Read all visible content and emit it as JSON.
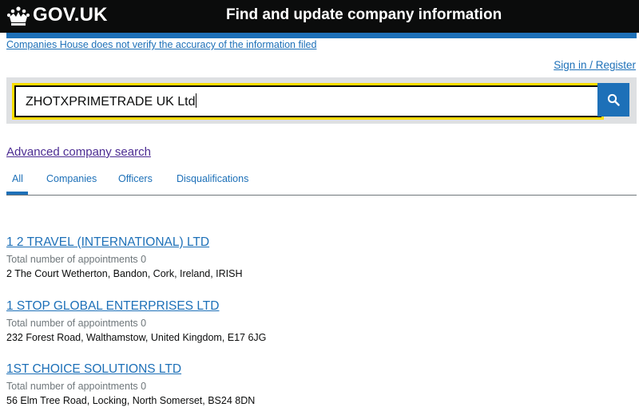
{
  "header": {
    "logo_text": "GOV.UK",
    "logo_icon": "crown-icon",
    "service_name": "Find and update company information"
  },
  "disclaimer": "Companies House does not verify the accuracy of the information filed",
  "signin": "Sign in / Register",
  "search": {
    "value": "ZHOTXPRIMETRADE UK Ltd",
    "button_icon": "search-icon"
  },
  "advanced_search": "Advanced company search",
  "tabs": [
    {
      "label": "All",
      "active": true
    },
    {
      "label": "Companies",
      "active": false
    },
    {
      "label": "Officers",
      "active": false
    },
    {
      "label": "Disqualifications",
      "active": false
    }
  ],
  "results": [
    {
      "title": "1 2 TRAVEL (INTERNATIONAL) LTD",
      "meta": "Total number of appointments 0",
      "address": "2 The Court Wetherton, Bandon, Cork, Ireland, IRISH"
    },
    {
      "title": "1 STOP GLOBAL ENTERPRISES LTD",
      "meta": "Total number of appointments 0",
      "address": "232 Forest Road, Walthamstow, United Kingdom, E17 6JG"
    },
    {
      "title": "1ST CHOICE SOLUTIONS LTD",
      "meta": "Total number of appointments 0",
      "address": "56 Elm Tree Road, Locking, North Somerset, BS24 8DN"
    }
  ],
  "colors": {
    "header_bg": "#0b0c0c",
    "link": "#1d70b8",
    "visited_link": "#4c2c92",
    "focus": "#ffdd00",
    "panel": "#dee0e2"
  }
}
